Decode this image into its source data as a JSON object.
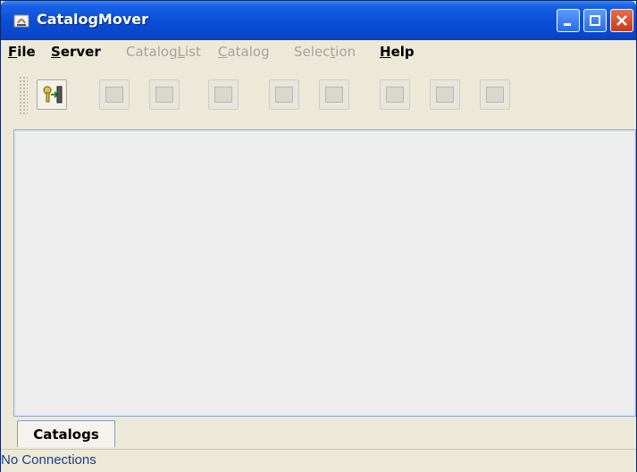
{
  "window": {
    "title": "CatalogMover"
  },
  "menu": {
    "items": [
      {
        "label": "File",
        "mnemonic": "F",
        "rest": "ile",
        "enabled": true
      },
      {
        "label": "Server",
        "mnemonic": "S",
        "rest": "erver",
        "enabled": true
      },
      {
        "label": "CatalogList",
        "pre": "Catalog",
        "mnemonic": "L",
        "rest": "ist",
        "enabled": false
      },
      {
        "label": "Catalog",
        "mnemonic": "C",
        "rest": "atalog",
        "enabled": false
      },
      {
        "label": "Selection",
        "pre": "Selec",
        "mnemonic": "t",
        "rest": "ion",
        "enabled": false
      },
      {
        "label": "Help",
        "mnemonic": "H",
        "rest": "elp",
        "enabled": true
      }
    ]
  },
  "toolbar": {
    "buttons": [
      {
        "icon": "connect-icon",
        "enabled": true
      },
      {
        "icon": "catalog-icon",
        "enabled": false
      },
      {
        "icon": "catalog-icon",
        "enabled": false
      },
      {
        "icon": "catalog-file-icon",
        "enabled": false
      },
      {
        "icon": "disk-icon",
        "enabled": false
      },
      {
        "icon": "disk-text-icon",
        "enabled": false
      },
      {
        "icon": "list-icon",
        "enabled": false
      },
      {
        "icon": "list-alt-icon",
        "enabled": false
      },
      {
        "icon": "table-icon",
        "enabled": false
      }
    ]
  },
  "tabs": [
    {
      "label": "Catalogs",
      "selected": true
    }
  ],
  "status": {
    "text": "No Connections"
  },
  "colors": {
    "titlebar": "#0a4fd8",
    "window_bg": "#ece9d8",
    "content_bg": "#eeeeee",
    "status_text": "#1b3f8f",
    "close_button": "#c93818"
  }
}
